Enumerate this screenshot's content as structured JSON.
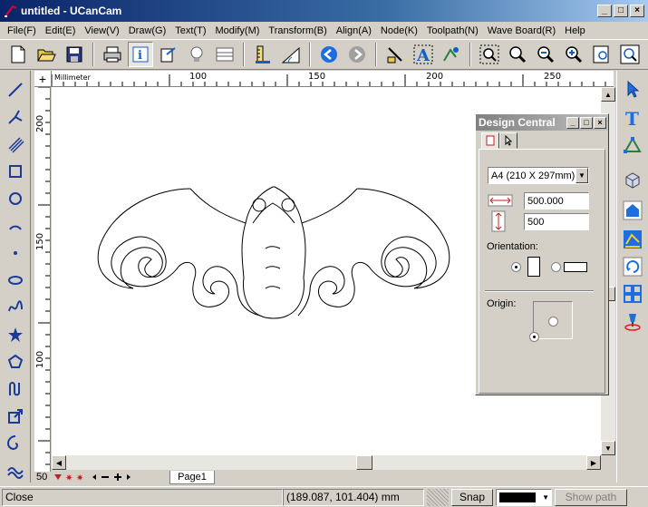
{
  "window": {
    "title": "untitled - UCanCam",
    "minimize": "_",
    "maximize": "□",
    "close": "×"
  },
  "menu": [
    "File(F)",
    "Edit(E)",
    "View(V)",
    "Draw(G)",
    "Text(T)",
    "Modify(M)",
    "Transform(B)",
    "Align(A)",
    "Node(K)",
    "Toolpath(N)",
    "Wave Board(R)",
    "Help"
  ],
  "toolbar": [
    "new-file-icon",
    "open-file-icon",
    "save-icon",
    "print-icon",
    "info-icon",
    "node-edit-icon",
    "bulb-icon",
    "layers-icon",
    "ruler-icon",
    "measure-icon",
    "back-icon",
    "forward-icon",
    "brush-icon",
    "text-art-icon",
    "design-icon",
    "zoom-window-icon",
    "zoom-in-icon",
    "zoom-out-icon",
    "zoom-plus-icon",
    "zoom-page-icon",
    "zoom-fit-icon"
  ],
  "left_tools": [
    "line-icon",
    "polyline-icon",
    "multi-line-icon",
    "rectangle-icon",
    "circle-icon",
    "arc-icon",
    "point-icon",
    "ellipse-icon",
    "spiral-wave-icon",
    "star-icon",
    "polygon-icon",
    "pen-icon",
    "transform-icon",
    "spiral-icon",
    "wave-icon"
  ],
  "right_tools": [
    "pointer-icon",
    "text-tool-icon",
    "node-tool-icon",
    "3d-icon",
    "cube-icon",
    "engrave-icon",
    "rotate-icon",
    "grid-icon",
    "fill-icon"
  ],
  "ruler": {
    "unit": "Millimeter",
    "h_labels": [
      "100",
      "150",
      "200",
      "250"
    ],
    "v_labels": [
      "200",
      "150",
      "100",
      "50"
    ]
  },
  "page_tab": "Page1",
  "status": {
    "left": "Close",
    "coords": "(189.087, 101.404) mm",
    "snap": "Snap",
    "show_path": "Show path"
  },
  "design_central": {
    "title": "Design Central",
    "page_size": "A4 (210 X 297mm)",
    "width": "500.000",
    "height": "500",
    "orientation_label": "Orientation:",
    "origin_label": "Origin:"
  }
}
